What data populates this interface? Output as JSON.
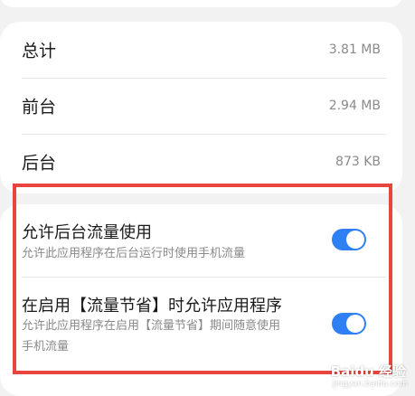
{
  "usage": {
    "rows": [
      {
        "label": "总计",
        "value": "3.81 MB"
      },
      {
        "label": "前台",
        "value": "2.94 MB"
      },
      {
        "label": "后台",
        "value": "873 KB"
      }
    ]
  },
  "settings": {
    "items": [
      {
        "title": "允许后台流量使用",
        "description": "允许此应用程序在后台运行时使用手机流量",
        "enabled": true
      },
      {
        "title": "在启用【流量节省】时允许应用程序",
        "description_line1": "允许此应用程序在启用【流量节省】期间随意使用",
        "description_line2": "手机流量",
        "enabled": true
      }
    ]
  },
  "colors": {
    "toggle_on": "#2f7ff5",
    "highlight_border": "#e8463c"
  },
  "watermark": {
    "brand": "Baidu 经验",
    "domain": "jingyan.baidu.com"
  }
}
